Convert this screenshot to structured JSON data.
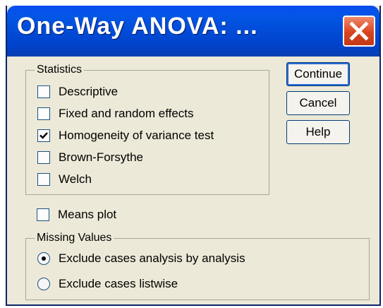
{
  "window": {
    "title": "One-Way ANOVA: ...",
    "close_icon": "close-icon"
  },
  "statistics": {
    "label": "Statistics",
    "options": [
      {
        "label": "Descriptive",
        "checked": false
      },
      {
        "label": "Fixed and random effects",
        "checked": false
      },
      {
        "label": "Homogeneity of variance test",
        "checked": true
      },
      {
        "label": "Brown-Forsythe",
        "checked": false
      },
      {
        "label": "Welch",
        "checked": false
      }
    ]
  },
  "means_plot": {
    "label": "Means plot",
    "checked": false
  },
  "missing_values": {
    "label": "Missing Values",
    "options": [
      {
        "label": "Exclude cases analysis by analysis",
        "selected": true
      },
      {
        "label": "Exclude cases listwise",
        "selected": false
      }
    ]
  },
  "buttons": {
    "continue": "Continue",
    "cancel": "Cancel",
    "help": "Help"
  }
}
